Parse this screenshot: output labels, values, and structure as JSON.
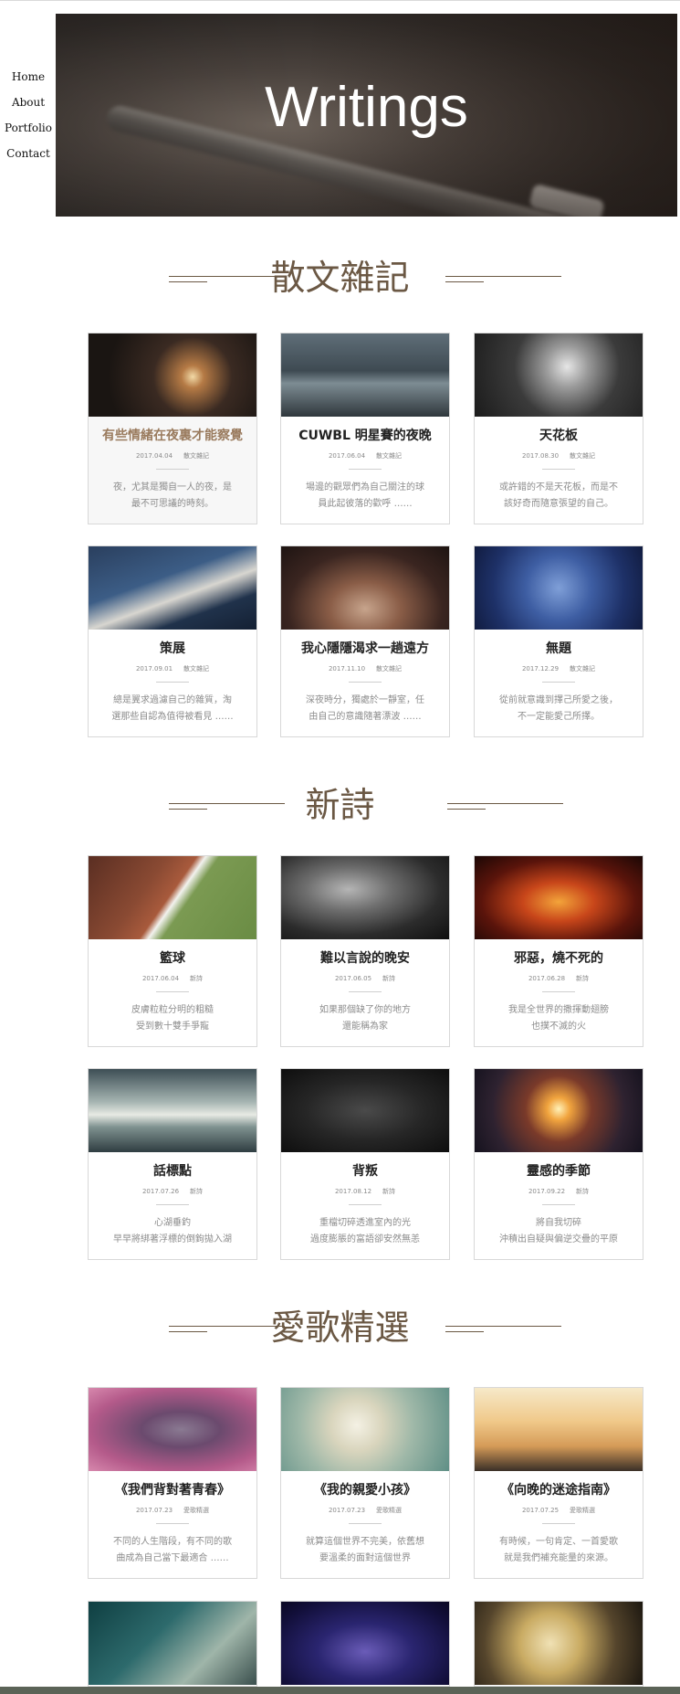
{
  "nav": {
    "items": [
      "Home",
      "About",
      "Portfolio",
      "Contact"
    ]
  },
  "hero": {
    "title": "Writings"
  },
  "sections": [
    {
      "title": "散文雜記"
    },
    {
      "title": "新詩"
    },
    {
      "title": "愛歌精選"
    }
  ],
  "cards": [
    {
      "title": "有些情緒在夜裏才能察覺",
      "date": "2017.04.04",
      "category": "散文雜記",
      "excerpt1": "夜，尤其是獨自一人的夜，是",
      "excerpt2": "最不可思議的時刻。"
    },
    {
      "title": "CUWBL 明星賽的夜晚",
      "date": "2017.06.04",
      "category": "散文雜記",
      "excerpt1": "場邊的觀眾們為自己關注的球",
      "excerpt2": "員此起彼落的歡呼 ……"
    },
    {
      "title": "天花板",
      "date": "2017.08.30",
      "category": "散文雜記",
      "excerpt1": "或許錯的不是天花板，而是不",
      "excerpt2": "該好奇而隨意張望的自己。"
    },
    {
      "title": "策展",
      "date": "2017.09.01",
      "category": "散文雜記",
      "excerpt1": "總是翼求過濾自己的雜質，淘",
      "excerpt2": "選那些自認為值得被看見 ……"
    },
    {
      "title": "我心隱隱渴求一趟遠方",
      "date": "2017.11.10",
      "category": "散文雜記",
      "excerpt1": "深夜時分，獨處於一靜室，任",
      "excerpt2": "由自己的意識隨著漂波 ……"
    },
    {
      "title": "無題",
      "date": "2017.12.29",
      "category": "散文雜記",
      "excerpt1": "從前就意識到擇己所愛之後，",
      "excerpt2": "不一定能愛己所擇。"
    },
    {
      "title": "籃球",
      "date": "2017.06.04",
      "category": "新詩",
      "excerpt1": "皮膚粒粒分明的粗糙",
      "excerpt2": "受到數十雙手爭寵"
    },
    {
      "title": "難以言說的晚安",
      "date": "2017.06.05",
      "category": "新詩",
      "excerpt1": "如果那個缺了你的地方",
      "excerpt2": "還能稱為家"
    },
    {
      "title": "邪惡，燒不死的",
      "date": "2017.06.28",
      "category": "新詩",
      "excerpt1": "我是全世界的撒揮動翅膀",
      "excerpt2": "也撲不滅的火"
    },
    {
      "title": "話標點",
      "date": "2017.07.26",
      "category": "新詩",
      "excerpt1": "心湖垂釣",
      "excerpt2": "早早將綁著浮標的倒鉤拋入湖"
    },
    {
      "title": "背叛",
      "date": "2017.08.12",
      "category": "新詩",
      "excerpt1": "重檔切碎透進室內的光",
      "excerpt2": "過度膨脹的富語卻安然無恙"
    },
    {
      "title": "靈感的季節",
      "date": "2017.09.22",
      "category": "新詩",
      "excerpt1": "將自我切碎",
      "excerpt2": "沖積出自疑與偏逆交疊的平原"
    },
    {
      "title": "《我們背對著青春》",
      "date": "2017.07.23",
      "category": "愛歌精選",
      "excerpt1": "不同的人生階段，有不同的歌",
      "excerpt2": "曲成為自己當下最適合 ……"
    },
    {
      "title": "《我的親愛小孩》",
      "date": "2017.07.23",
      "category": "愛歌精選",
      "excerpt1": "就算這個世界不完美，依舊想",
      "excerpt2": "要溫柔的面對這個世界"
    },
    {
      "title": "《向晚的迷途指南》",
      "date": "2017.07.25",
      "category": "愛歌精選",
      "excerpt1": "有時候，一句肯定、一首愛歌",
      "excerpt2": "就是我們補充能量的來源。"
    },
    {
      "title": "",
      "date": "",
      "category": "",
      "excerpt1": "",
      "excerpt2": ""
    },
    {
      "title": "",
      "date": "",
      "category": "",
      "excerpt1": "",
      "excerpt2": ""
    },
    {
      "title": "",
      "date": "",
      "category": "",
      "excerpt1": "",
      "excerpt2": ""
    }
  ]
}
